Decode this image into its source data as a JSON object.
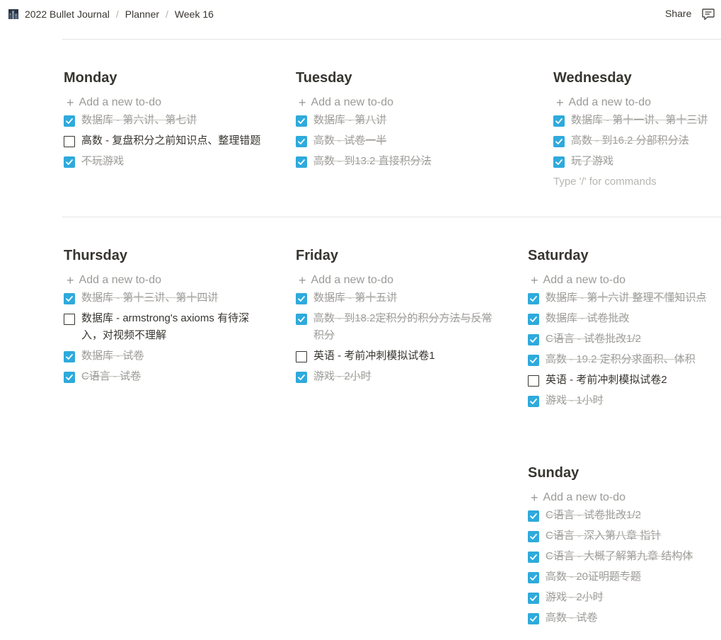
{
  "breadcrumb": [
    "2022 Bullet Journal",
    "Planner",
    "Week 16"
  ],
  "header": {
    "share_label": "Share",
    "comment_icon": "comment-icon",
    "page_icon": "city-image-icon"
  },
  "add_todo_label": "Add a new to-do",
  "colors": {
    "checkbox_checked": "#2eaadc",
    "text": "#37352f",
    "muted": "#9b9a97"
  },
  "days": [
    {
      "title": "Monday",
      "todos": [
        {
          "text": "数据库 - 第六讲、第七讲",
          "done": true
        },
        {
          "text": "高数 - 复盘积分之前知识点、整理错题",
          "done": false
        },
        {
          "text": "不玩游戏",
          "done": true
        }
      ]
    },
    {
      "title": "Tuesday",
      "todos": [
        {
          "text": "数据库 - 第八讲",
          "done": true
        },
        {
          "text": "高数 - 试卷一半",
          "done": true
        },
        {
          "text": "高数 - 到13.2 直接积分法",
          "done": true
        }
      ]
    },
    {
      "title": "Wednesday",
      "placeholder": "Type '/' for commands",
      "todos": [
        {
          "text": "数据库 - 第十一讲、第十三讲",
          "done": true
        },
        {
          "text": "高数 - 到16.2 分部积分法",
          "done": true
        },
        {
          "text": "玩了游戏",
          "done": true
        }
      ]
    },
    {
      "title": "Thursday",
      "todos": [
        {
          "text": "数据库 - 第十三讲、第十四讲",
          "done": true
        },
        {
          "text": "数据库 - armstrong's axioms 有待深入，对视频不理解",
          "done": false
        },
        {
          "text": "数据库 - 试卷",
          "done": true
        },
        {
          "text": "C语言 - 试卷",
          "done": true
        }
      ]
    },
    {
      "title": "Friday",
      "todos": [
        {
          "text": "数据库 - 第十五讲",
          "done": true
        },
        {
          "text": "高数 - 到18.2定积分的积分方法与反常积分",
          "done": true
        },
        {
          "text": "英语 - 考前冲刺模拟试卷1",
          "done": false
        },
        {
          "text": "游戏 - 2小时",
          "done": true
        }
      ]
    },
    {
      "title": "Saturday",
      "todos": [
        {
          "text": "数据库 - 第十六讲 整理不懂知识点",
          "done": true
        },
        {
          "text": "数据库 - 试卷批改",
          "done": true
        },
        {
          "text": "C语言 - 试卷批改1/2",
          "done": true
        },
        {
          "text": "高数 - 19.2 定积分求面积、体积",
          "done": true
        },
        {
          "text": "英语 - 考前冲刺模拟试卷2",
          "done": false
        },
        {
          "text": "游戏 - 1小时",
          "done": true
        }
      ]
    },
    {
      "title": "Sunday",
      "todos": [
        {
          "text": "C语言 - 试卷批改1/2",
          "done": true
        },
        {
          "text": "C语言 - 深入第八章 指针",
          "done": true
        },
        {
          "text": "C语言 - 大概了解第九章 结构体",
          "done": true
        },
        {
          "text": "高数 - 20证明题专题",
          "done": true
        },
        {
          "text": "游戏 - 2小时",
          "done": true
        },
        {
          "text": "高数 - 试卷",
          "done": true
        }
      ]
    }
  ]
}
